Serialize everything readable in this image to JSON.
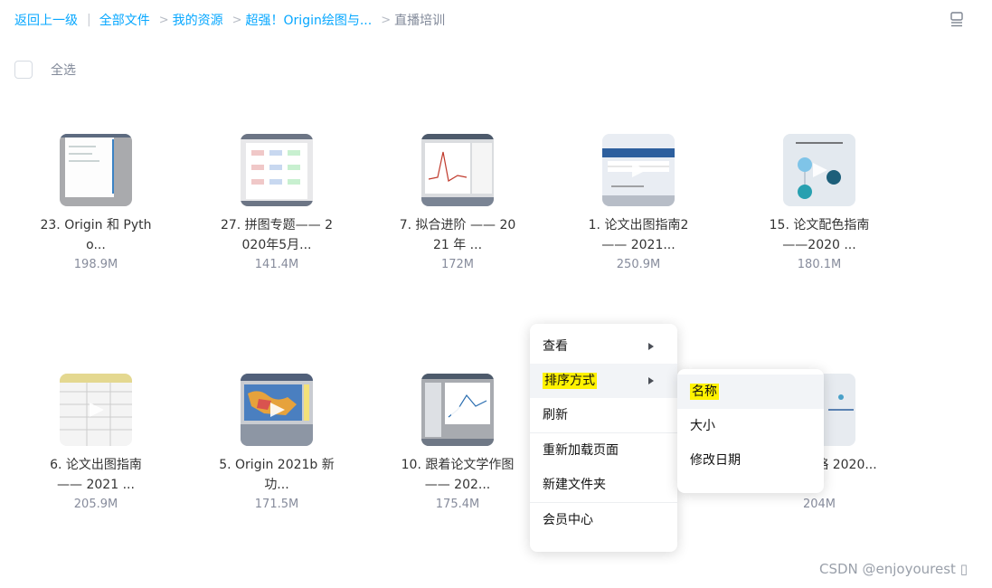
{
  "breadcrumb": {
    "back": "返回上一级",
    "items": [
      "全部文件",
      "我的资源",
      "超强！Origin绘图与...",
      "直播培训"
    ]
  },
  "select_all_label": "全选",
  "files": [
    {
      "name": "23. Origin 和 Pytho...",
      "size": "198.9M"
    },
    {
      "name": "27. 拼图专题—— 2020年5月...",
      "size": "141.4M"
    },
    {
      "name": "7. 拟合进阶 —— 2021 年 ...",
      "size": "172M"
    },
    {
      "name": "1. 论文出图指南2 —— 2021...",
      "size": "250.9M"
    },
    {
      "name": "15. 论文配色指南 ——2020 ...",
      "size": "180.1M"
    },
    {
      "name": "6. 论文出图指南 —— 2021 ...",
      "size": "205.9M"
    },
    {
      "name": "5. Origin 2021b 新功...",
      "size": "171.5M"
    },
    {
      "name": "10. 跟着论文学作图 —— 202...",
      "size": "175.4M"
    },
    {
      "name": "绘制攻略 2020...",
      "size": "204M"
    }
  ],
  "context_menu": {
    "items": [
      "查看",
      "排序方式",
      "刷新",
      "重新加载页面",
      "新建文件夹",
      "会员中心"
    ]
  },
  "sort_submenu": {
    "items": [
      "名称",
      "大小",
      "修改日期"
    ]
  },
  "watermark": "CSDN @enjoyourest ▯",
  "colors": {
    "link": "#06a7ff",
    "highlight": "#fff200",
    "menu_hover": "#f2f4f7"
  }
}
